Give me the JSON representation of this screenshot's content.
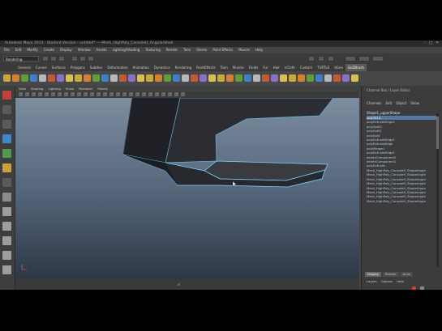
{
  "window": {
    "title": "Autodesk Maya 2014 - Student Version - untitled* --- Mesh_HighPoly_ConsoleH_AngularShell",
    "controls": [
      "–",
      "□",
      "✕"
    ]
  },
  "menubar": [
    "File",
    "Edit",
    "Modify",
    "Create",
    "Display",
    "Window",
    "Assets",
    "Lighting/Shading",
    "Texturing",
    "Render",
    "Toon",
    "Stereo",
    "Paint Effects",
    "Muscle",
    "Help"
  ],
  "statusline": {
    "mode": "Rendering"
  },
  "shelf": {
    "tabs": [
      "General",
      "Curves",
      "Surfaces",
      "Polygons",
      "Subdivs",
      "Deformation",
      "Animation",
      "Dynamics",
      "Rendering",
      "PaintEffects",
      "Toon",
      "Muscle",
      "Fluids",
      "Fur",
      "Hair",
      "nCloth",
      "Custom",
      "TURTLE",
      "XGen",
      "GoZBrush"
    ],
    "active_tab": "GoZBrush"
  },
  "viewport": {
    "menu": [
      "View",
      "Shading",
      "Lighting",
      "Show",
      "Renderer",
      "Panels"
    ]
  },
  "channel_box": {
    "title": "Channel Box / Layer Editor",
    "tabs": [
      "Channels",
      "Edit",
      "Object",
      "Show"
    ],
    "node_name": "Shape1_upperShape",
    "inputs": [
      "polyTk14",
      "polyExtrudeEdge2",
      "polySplit2",
      "polySplit1",
      "polySplit",
      "polyExtrudeEdge1",
      "polyExtrudeEdge",
      "polyMerge1",
      "polyExtrudeEdge1",
      "deleteComponent2",
      "deleteComponent1",
      "polyExtrude",
      "Mesh_HighPoly_ConsoleH_ShapeAngle",
      "Mesh_HighPoly_ConsoleH_ShapeAngle",
      "Mesh_HighPoly_ConsoleH_ShapeAngle",
      "Mesh_HighPoly_ConsoleH_ShapeAngle",
      "Mesh_HighPoly_ConsoleH_ShapeAngle",
      "Mesh_HighPoly_ConsoleH_ShapeAngle",
      "Mesh_HighPoly_ConsoleH_ShapeAngle",
      "Mesh_HighPoly_ConsoleH_ShapeAngle"
    ],
    "layer_tabs": [
      "Display",
      "Render",
      "Anim"
    ],
    "layer_menu": [
      "Layers",
      "Options",
      "Help"
    ]
  },
  "colors": {
    "accent": "#5577a0",
    "wire": "#7fd3ff"
  }
}
